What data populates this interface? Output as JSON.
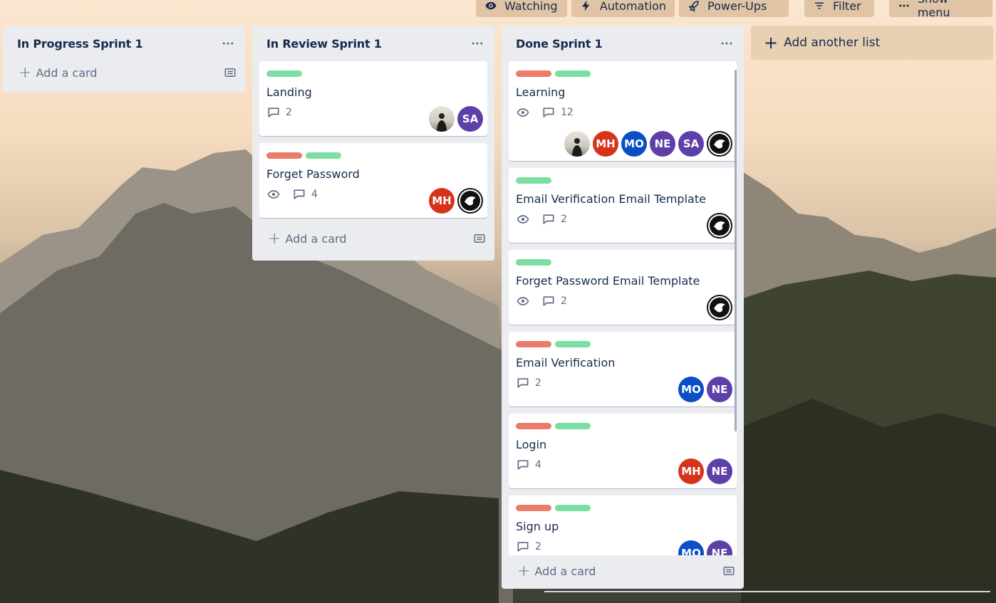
{
  "colors": {
    "label_green": "#7bdfa1",
    "label_red": "#eb7b6b",
    "avatar_mh": "#d6331b",
    "avatar_mo": "#0a4fc6",
    "avatar_ne": "#5d3fa8",
    "avatar_sa": "#5d3fa8"
  },
  "header": {
    "watching": "Watching",
    "automation": "Automation",
    "powerups": "Power-Ups",
    "filter": "Filter",
    "show_menu": "Show menu"
  },
  "lists": [
    {
      "title": "In Progress Sprint 1",
      "add_card": "Add a card",
      "cards": []
    },
    {
      "title": "In Review Sprint 1",
      "add_card": "Add a card",
      "cards": [
        {
          "title": "Landing",
          "labels": [
            "green"
          ],
          "watch": false,
          "comments": "2",
          "members": [
            "photo",
            "SA"
          ]
        },
        {
          "title": "Forget Password",
          "labels": [
            "red",
            "green"
          ],
          "watch": true,
          "comments": "4",
          "members": [
            "MH",
            "logo"
          ]
        }
      ]
    },
    {
      "title": "Done Sprint 1",
      "add_card": "Add a card",
      "cards": [
        {
          "title": "Learning",
          "labels": [
            "red",
            "green"
          ],
          "watch": true,
          "comments": "12",
          "members": [
            "photo",
            "MH",
            "MO",
            "NE",
            "SA",
            "logo"
          ]
        },
        {
          "title": "Email Verification Email Template",
          "labels": [
            "green"
          ],
          "watch": true,
          "comments": "2",
          "members": [
            "logo"
          ]
        },
        {
          "title": "Forget Password Email Template",
          "labels": [
            "green"
          ],
          "watch": true,
          "comments": "2",
          "members": [
            "logo"
          ]
        },
        {
          "title": "Email Verification",
          "labels": [
            "red",
            "green"
          ],
          "watch": false,
          "comments": "2",
          "members": [
            "MO",
            "NE"
          ]
        },
        {
          "title": "Login",
          "labels": [
            "red",
            "green"
          ],
          "watch": false,
          "comments": "4",
          "members": [
            "MH",
            "NE"
          ]
        },
        {
          "title": "Sign up",
          "labels": [
            "red",
            "green"
          ],
          "watch": false,
          "comments": "2",
          "members": [
            "MO",
            "NE"
          ]
        }
      ]
    }
  ],
  "add_list": "Add another list"
}
